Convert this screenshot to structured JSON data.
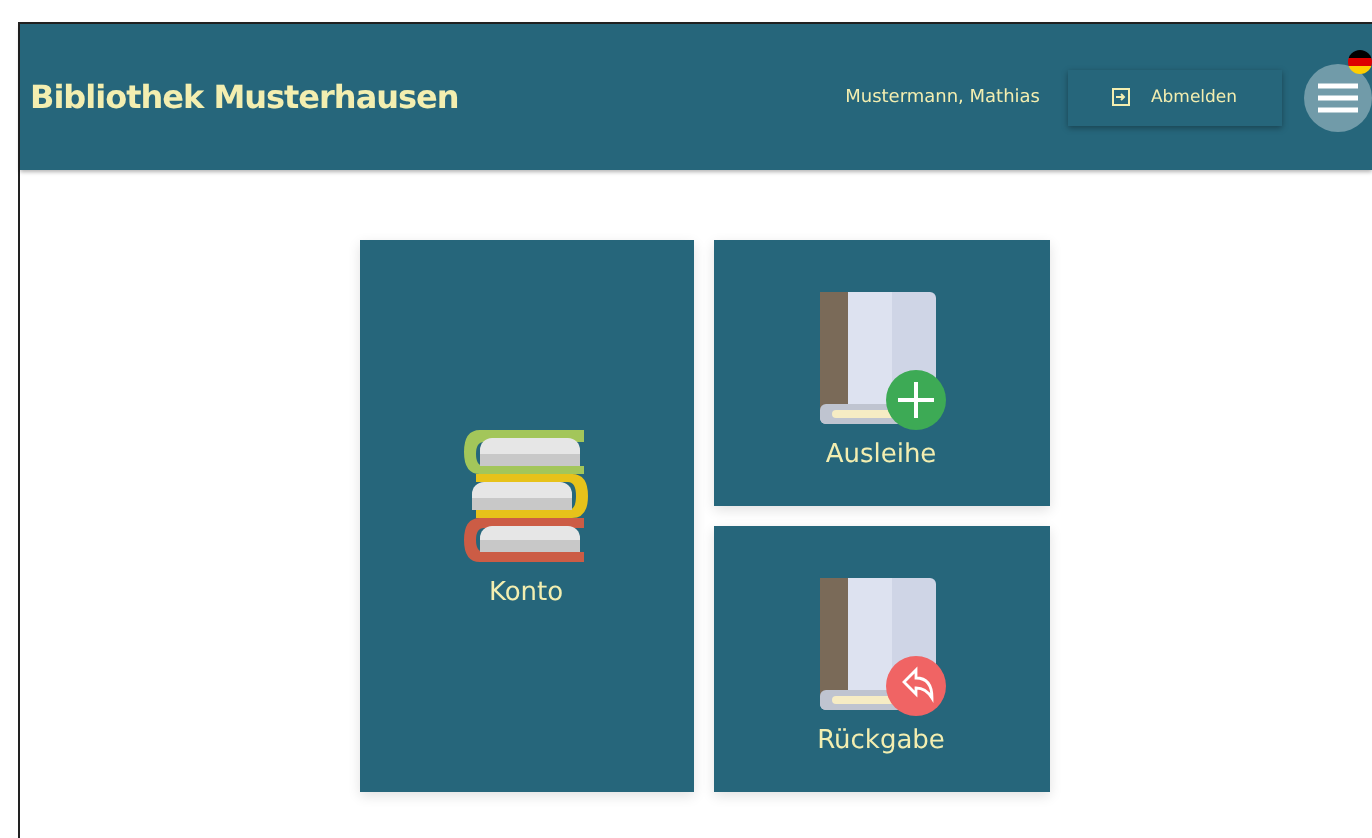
{
  "header": {
    "title": "Bibliothek Musterhausen",
    "user": "Mustermann, Mathias",
    "logout_button": "Abmelden"
  },
  "tiles": [
    {
      "kind": "stack",
      "label": "Konto"
    },
    {
      "kind": "add",
      "label": "Ausleihe"
    },
    {
      "kind": "return",
      "label": "Rückgabe"
    }
  ]
}
